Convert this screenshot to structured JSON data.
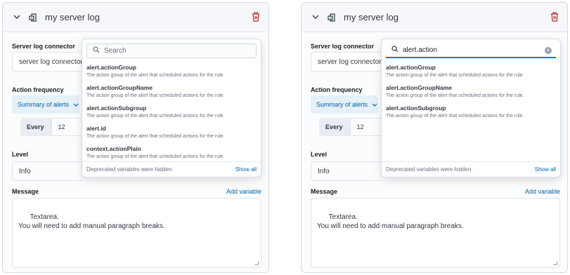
{
  "panels": [
    {
      "title": "my server log",
      "connector_label": "Server log connector",
      "connector_value": "server log connector",
      "frequency_label": "Action frequency",
      "summary_label": "Summary of alerts",
      "every_label": "Every",
      "every_value": "12",
      "level_label": "Level",
      "level_value": "Info",
      "message_label": "Message",
      "add_variable": "Add variable",
      "message_text": "Textarea.\nYou will need to add manual paragraph breaks.",
      "popover": {
        "search_placeholder": "Search",
        "search_value": "",
        "items": [
          {
            "name": "alert.actionGroup",
            "desc": "The action group of the alert that scheduled actions for the rule."
          },
          {
            "name": "alert.actionGroupName",
            "desc": "The action group of the alert that scheduled actions for the rule."
          },
          {
            "name": "alert.actionSubgroup",
            "desc": "The action group of the alert that scheduled actions for the rule."
          },
          {
            "name": "alert.id",
            "desc": "The action group of the alert that scheduled actions for the rule."
          },
          {
            "name": "context.actionPlain",
            "desc": "The action group of the alert that scheduled actions for the rule."
          }
        ],
        "footer_text": "Deprecated variables were hidden.",
        "show_all": "Show all"
      }
    },
    {
      "title": "my server log",
      "connector_label": "Server log connector",
      "connector_value": "server log connector",
      "frequency_label": "Action frequency",
      "summary_label": "Summary of alerts",
      "every_label": "Every",
      "every_value": "12",
      "level_label": "Level",
      "level_value": "Info",
      "message_label": "Message",
      "add_variable": "Add variable",
      "message_text": "Textarea.\nYou will need to add manual paragraph breaks.",
      "popover": {
        "search_placeholder": "Search",
        "search_value": "alert.action",
        "items": [
          {
            "name": "alert.actionGroup",
            "desc": "The action group of the alert that scheduled actions for the rule."
          },
          {
            "name": "alert.actionGroupName",
            "desc": "The action group of the alert that scheduled actions for the rule."
          },
          {
            "name": "alert.actionSubgroup",
            "desc": "The action group of the alert that scheduled actions for the rule."
          }
        ],
        "footer_text": "Deprecated variables were hidden.",
        "show_all": "Show all"
      }
    }
  ],
  "colors": {
    "link": "#0061a6",
    "danger": "#bd271e",
    "focus": "#0077cc"
  },
  "icons": [
    "chevron-down-icon",
    "connector-icon",
    "trash-icon",
    "search-icon",
    "clear-icon",
    "dropdown-chevron-icon"
  ]
}
